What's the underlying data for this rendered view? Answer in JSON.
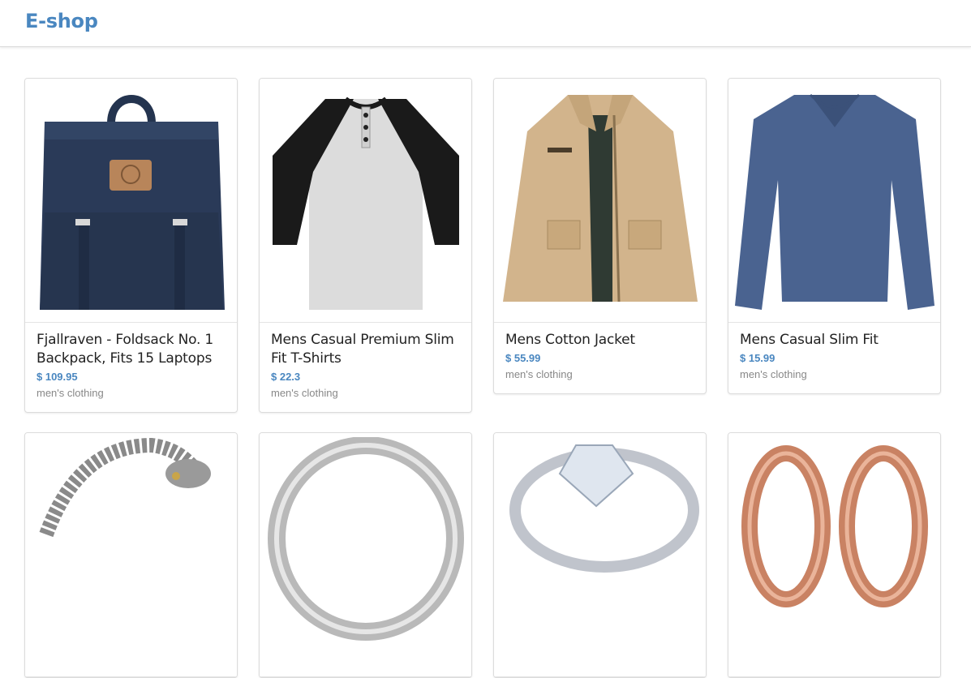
{
  "header": {
    "brand": "E-shop"
  },
  "products": [
    {
      "title": "Fjallraven - Foldsack No. 1 Backpack, Fits 15 Laptops",
      "price": "$ 109.95",
      "category": "men's clothing",
      "image_icon": "backpack-icon"
    },
    {
      "title": "Mens Casual Premium Slim Fit T-Shirts",
      "price": "$ 22.3",
      "category": "men's clothing",
      "image_icon": "raglan-tshirt-icon"
    },
    {
      "title": "Mens Cotton Jacket",
      "price": "$ 55.99",
      "category": "men's clothing",
      "image_icon": "jacket-icon"
    },
    {
      "title": "Mens Casual Slim Fit",
      "price": "$ 15.99",
      "category": "men's clothing",
      "image_icon": "longsleeve-shirt-icon"
    },
    {
      "title": "",
      "price": "",
      "category": "",
      "image_icon": "dragon-bracelet-icon"
    },
    {
      "title": "",
      "price": "",
      "category": "",
      "image_icon": "silver-ring-icon"
    },
    {
      "title": "",
      "price": "",
      "category": "",
      "image_icon": "diamond-ring-icon"
    },
    {
      "title": "",
      "price": "",
      "category": "",
      "image_icon": "rose-gold-earrings-icon"
    }
  ]
}
